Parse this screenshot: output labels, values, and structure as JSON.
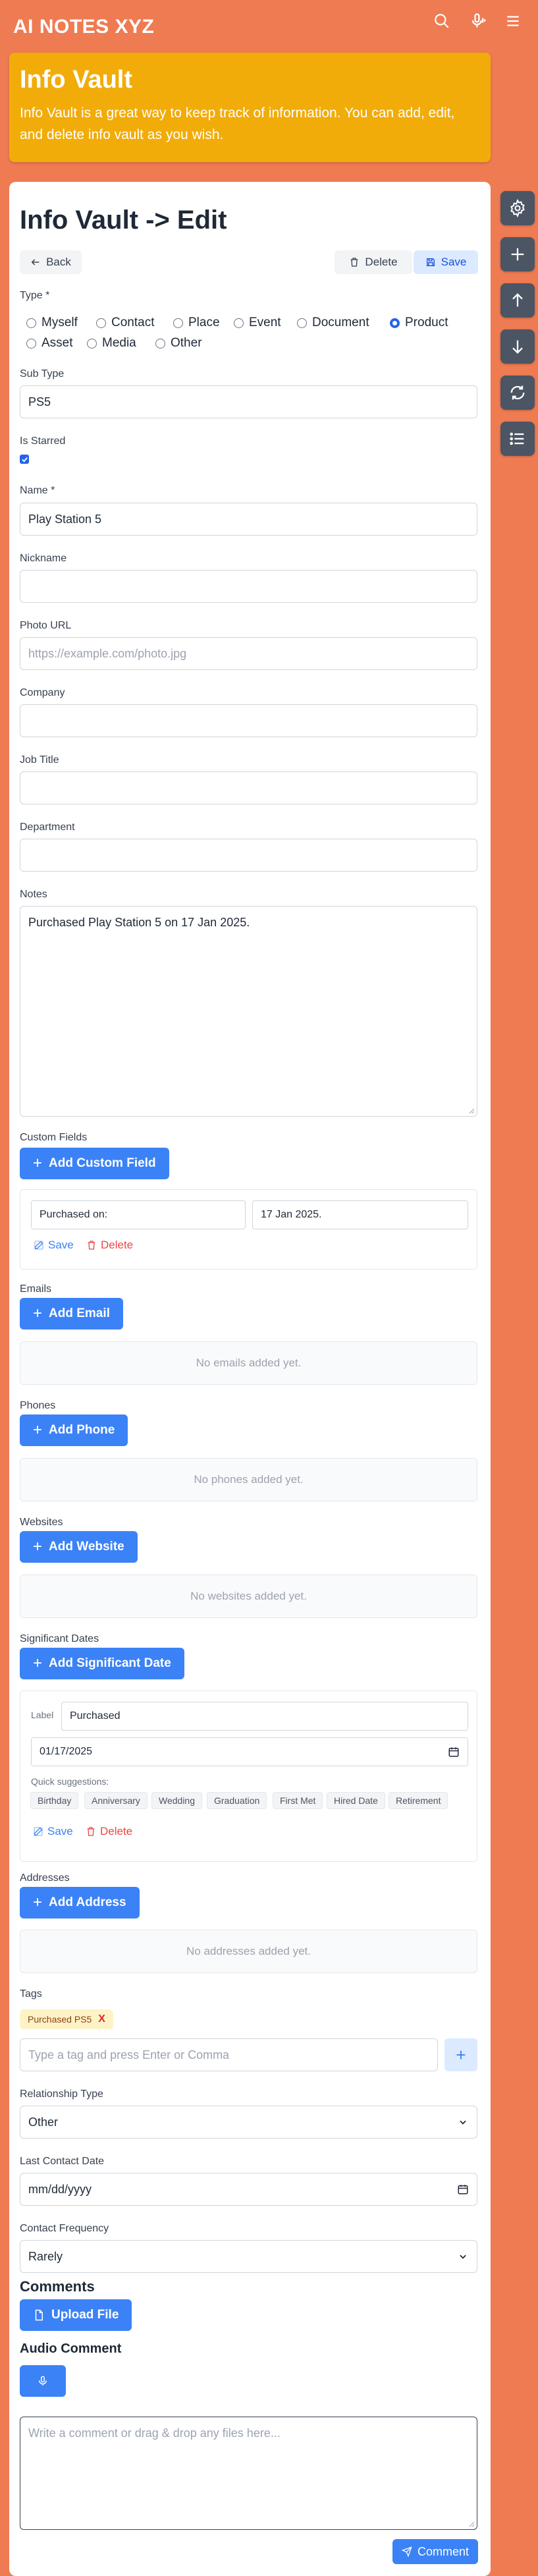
{
  "app": {
    "title": "AI NOTES XYZ"
  },
  "top_icons": [
    "search-icon",
    "microphone-voice-icon",
    "menu-icon"
  ],
  "banner": {
    "title": "Info Vault",
    "description": "Info Vault is a great way to keep track of information. You can add, edit, and delete info vault as you wish."
  },
  "sidebar_icons": [
    "settings-icon",
    "plus-icon",
    "arrow-up-icon",
    "arrow-down-icon",
    "refresh-icon",
    "list-icon"
  ],
  "page": {
    "title": "Info Vault -> Edit"
  },
  "toolbar": {
    "back_label": "Back",
    "delete_label": "Delete",
    "save_label": "Save"
  },
  "type": {
    "label": "Type *",
    "options": [
      "Myself",
      "Contact",
      "Place",
      "Event",
      "Document",
      "Product",
      "Asset",
      "Media",
      "Other"
    ],
    "selected": "Product"
  },
  "sub_type": {
    "label": "Sub Type",
    "value": "PS5"
  },
  "is_starred": {
    "label": "Is Starred",
    "checked": true
  },
  "name": {
    "label": "Name *",
    "value": "Play Station 5"
  },
  "nickname": {
    "label": "Nickname",
    "value": ""
  },
  "photo_url": {
    "label": "Photo URL",
    "placeholder": "https://example.com/photo.jpg"
  },
  "company": {
    "label": "Company",
    "value": ""
  },
  "job_title": {
    "label": "Job Title",
    "value": ""
  },
  "department": {
    "label": "Department",
    "value": ""
  },
  "notes": {
    "label": "Notes",
    "value": "Purchased Play Station 5 on 17 Jan 2025."
  },
  "custom_fields": {
    "label": "Custom Fields",
    "add_label": "Add Custom Field",
    "items": [
      {
        "key": "Purchased on:",
        "value": "17 Jan 2025."
      }
    ],
    "save_label": "Save",
    "delete_label": "Delete"
  },
  "emails": {
    "label": "Emails",
    "add_label": "Add Email",
    "empty": "No emails added yet."
  },
  "phones": {
    "label": "Phones",
    "add_label": "Add Phone",
    "empty": "No phones added yet."
  },
  "websites": {
    "label": "Websites",
    "add_label": "Add Website",
    "empty": "No websites added yet."
  },
  "significant_dates": {
    "label": "Significant Dates",
    "add_label": "Add Significant Date",
    "item": {
      "label_caption": "Label",
      "label_value": "Purchased",
      "date_value": "01/17/2025"
    },
    "suggestions_label": "Quick suggestions:",
    "suggestions": [
      "Birthday",
      "Anniversary",
      "Wedding",
      "Graduation",
      "First Met",
      "Hired Date",
      "Retirement"
    ],
    "save_label": "Save",
    "delete_label": "Delete"
  },
  "addresses": {
    "label": "Addresses",
    "add_label": "Add Address",
    "empty": "No addresses added yet."
  },
  "tags": {
    "label": "Tags",
    "items": [
      "Purchased PS5"
    ],
    "remove_glyph": "X",
    "input_placeholder": "Type a tag and press Enter or Comma",
    "add_glyph": "+"
  },
  "relationship_type": {
    "label": "Relationship Type",
    "value": "Other"
  },
  "last_contact_date": {
    "label": "Last Contact Date",
    "value": "mm/dd/yyyy"
  },
  "contact_frequency": {
    "label": "Contact Frequency",
    "value": "Rarely"
  },
  "comments": {
    "label": "Comments",
    "upload_label": "Upload File",
    "audio_label": "Audio Comment",
    "placeholder": "Write a comment or drag & drop any files here...",
    "submit_label": "Comment"
  },
  "colors": {
    "accent": "#3b82f6",
    "header_bg": "#ef7b52",
    "banner_bg": "#f2ac09",
    "sidebar_btn": "#4b5563"
  }
}
